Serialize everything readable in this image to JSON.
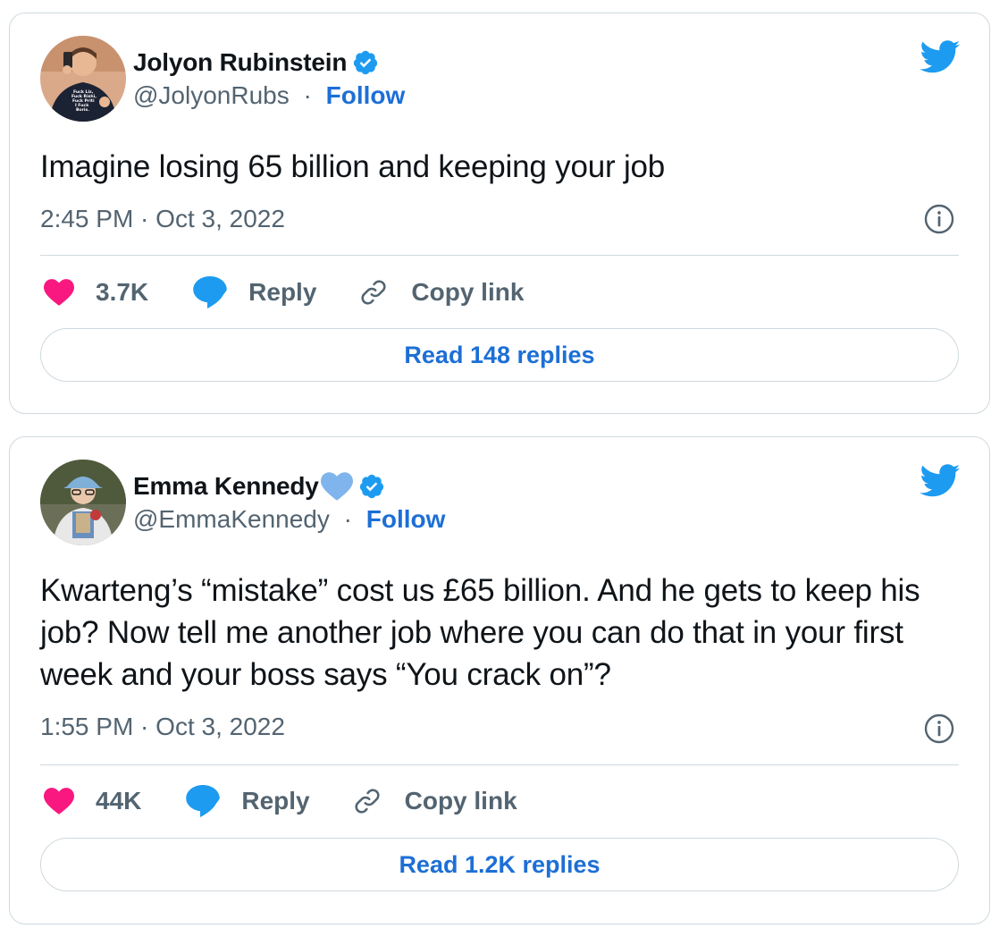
{
  "tweets": [
    {
      "name": "Jolyon Rubinstein",
      "handle": "@JolyonRubs",
      "separator": "·",
      "follow_label": "Follow",
      "text": "Imagine losing 65 billion and keeping your job",
      "timestamp": "2:45 PM · Oct 3, 2022",
      "likes": "3.7K",
      "reply_label": "Reply",
      "copy_link_label": "Copy link",
      "read_replies_label": "Read 148 replies"
    },
    {
      "name": "Emma Kennedy",
      "handle": "@EmmaKennedy",
      "separator": "·",
      "follow_label": "Follow",
      "text": "Kwarteng’s “mistake” cost us £65 billion. And he gets to keep his job? Now tell me another job where you can do that in your first week and your boss says “You crack on”?",
      "timestamp": "1:55 PM · Oct 3, 2022",
      "likes": "44K",
      "reply_label": "Reply",
      "copy_link_label": "Copy link",
      "read_replies_label": "Read 1.2K replies"
    }
  ],
  "avatar_shirt_text": "Fuck Liz, Fuck Rishi, Fuck Priti, I Fuck Boris.",
  "icons": {
    "verified": "verified-badge-icon",
    "twitter": "twitter-bird-icon",
    "like": "heart-icon",
    "reply": "speech-bubble-icon",
    "copy_link": "link-icon",
    "info": "info-icon",
    "name_emoji": "blue-heart-icon"
  },
  "colors": {
    "accent": "#1d6fd6",
    "twitter_blue": "#1d9bf0",
    "like_pink": "#f91880",
    "muted_text": "#536471",
    "border": "#cfd9de",
    "blue_heart": "#7fb4ec"
  }
}
